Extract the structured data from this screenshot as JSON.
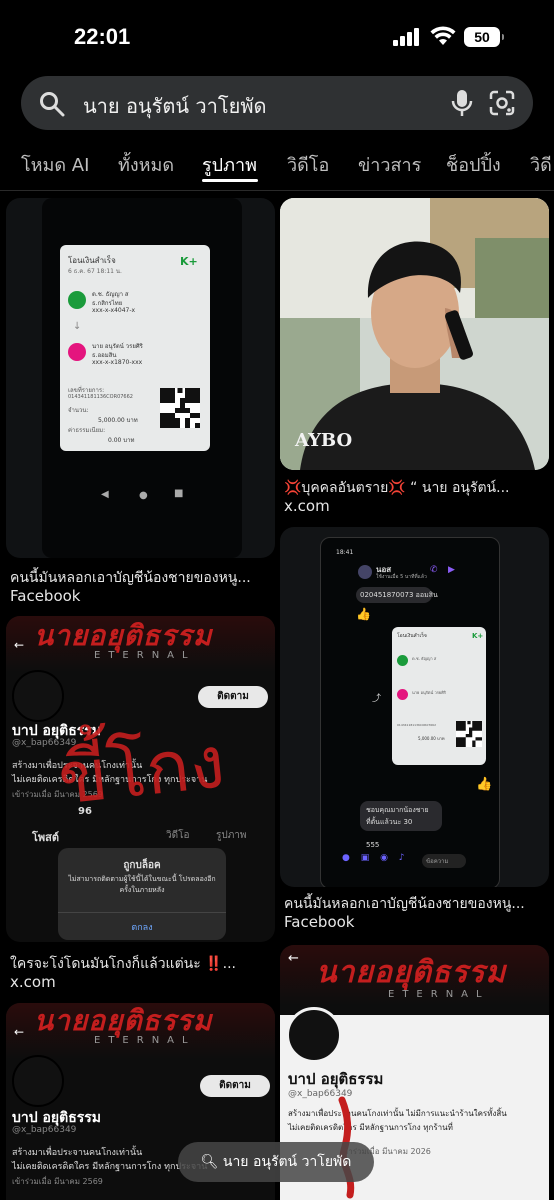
{
  "status_bar": {
    "time": "22:01",
    "battery": "50"
  },
  "search": {
    "query": "นาย อนุรัตน์ วาโยพัด"
  },
  "tabs": [
    "โหมด AI",
    "ทั้งหมด",
    "รูปภาพ",
    "วิดีโอ",
    "ข่าวสาร",
    "ช็อปปิ้ง",
    "วิดี"
  ],
  "active_tab": "รูปภาพ",
  "results": [
    {
      "caption": "คนนี้มันหลอกเอาบัญชีน้องชายของหนู...",
      "source": "Facebook",
      "slip": {
        "title": "โอนเงินสำเร็จ",
        "date": "6 ธ.ค. 67 18:11 น.",
        "from_name": "ด.ช. ธัญญา ส",
        "from_bank": "ธ.กสิกรไทย",
        "from_acct": "xxx-x-x4047-x",
        "to_name": "นาย อนุรัตน์ วรยศิริ",
        "to_bank": "ธ.ออมสิน",
        "to_acct": "xxx-x-x1870-xxx",
        "ref_label": "เลขที่รายการ:",
        "ref": "014341181136COR07662",
        "amount_label": "จำนวน:",
        "amount": "5,000.00 บาท",
        "fee_label": "ค่าธรรมเนียม:",
        "fee": "0.00 บาท",
        "kplus": "K+"
      }
    },
    {
      "caption": "💢บุคคลอันตราย💢 “ นาย อนุรัตน์...",
      "source": "x.com",
      "shirt_text": "AYBO"
    },
    {
      "caption": "ใครจะโง่โดนมันโกงก็แล้วแต่นะ ‼️...",
      "source": "x.com",
      "banner": "นายอยุติธรรม",
      "eternal": "ETERNAL",
      "follow": "ติดตาม",
      "name": "บาป อยุติธรรม",
      "handle": "@x_bap66349",
      "bio1": "สร้างมาเพื่อประจานคนโกงเท่านั้น",
      "bio2": "ไม่เคยติดเครดิตใคร มีหลักฐานการโกง ทุกประจาน",
      "joined": "เข้าร่วมเมื่อ มีนาคม 2569",
      "tab_posts": "โพสต์",
      "tab_video": "วิดีโอ",
      "tab_media": "รูปภาพ",
      "following": "96",
      "scribble": "ขี้โกง",
      "dialog_title": "ถูกบล็อค",
      "dialog_body": "ไม่สามารถติดตามผู้ใช้นี้ได้ในขณะนี้ โปรดลองอีกครั้งในภายหลัง",
      "dialog_btn": "ตกลง"
    },
    {
      "caption": "คนนี้มันหลอกเอาบัญชีน้องชายของหนู...",
      "source": "Facebook",
      "chat_time": "18:41",
      "chat_name": "นอส",
      "chat_status": "ใช้งานเมื่อ 5 นาทีที่แล้ว",
      "chat_msg": "020451870073 ออมสิน",
      "chat_r1": "ชอบคุณมากน้องชาย",
      "chat_r2": "ที่ตั้นแล้วนะ 30",
      "chat_num": "555",
      "chat_input": "ข้อความ"
    },
    {
      "banner": "นายอยุติธรรม",
      "eternal": "ETERNAL",
      "follow": "ติดตาม",
      "name": "บาป อยุติธรรม",
      "handle": "@x_bap66349",
      "bio1": "สร้างมาเพื่อประจานคนโกงเท่านั้น",
      "bio2": "ไม่เคยติดเครดิตใคร มีหลักฐานการโกง ทุกประจาน",
      "joined": "เข้าร่วมเมื่อ มีนาคม 2569"
    },
    {
      "banner": "นายอยุติธรรม",
      "eternal": "ETERNAL",
      "name": "บาป อยุติธรรม",
      "handle": "@x_bap66349",
      "bio1": "สร้างมาเพื่อประจานคนโกงเท่านั้น ไม่มีการแนะนำร้านใครทั้งสิ้น",
      "bio2": "ไม่เคยติดเครดิตใคร มีหลักฐานการโกง ทุกร้านที่",
      "joined": "เข้าร่วมเมื่อ มีนาคม 2026"
    }
  ],
  "floating_search": "นาย อนุรัตน์ วาโยพัด",
  "colors": {
    "background": "#000000",
    "search_bar": "#2f3133",
    "accent_red": "#c41e1e",
    "kplus_green": "#1a9b3b"
  }
}
